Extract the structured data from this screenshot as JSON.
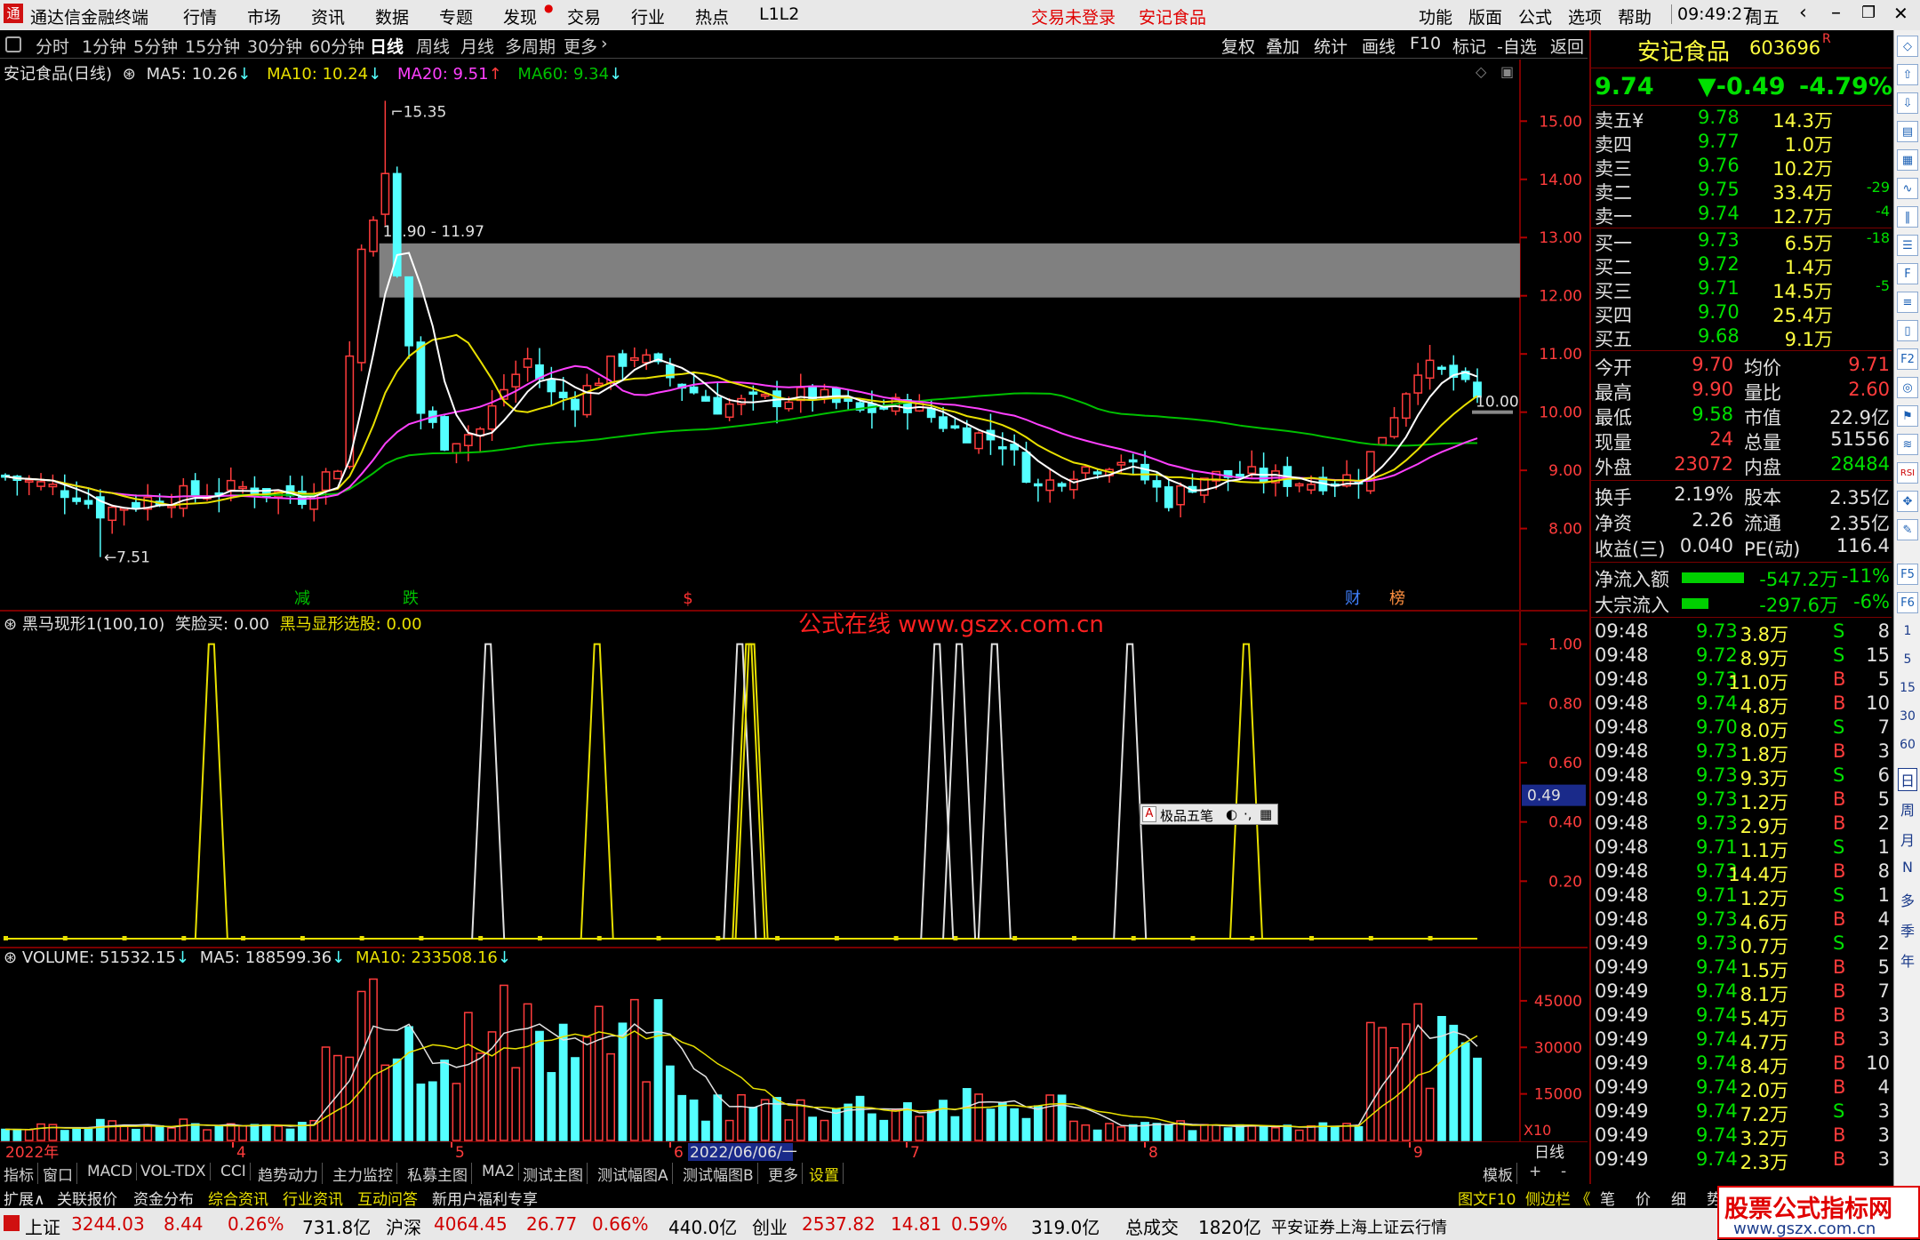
{
  "titlebar": {
    "app_name": "通达信金融终端",
    "menu": [
      "行情",
      "市场",
      "资讯",
      "数据",
      "专题",
      "发现",
      "交易",
      "行业",
      "热点",
      "L1L2"
    ],
    "status_login": "交易未登录",
    "status_stock": "安记食品",
    "right_menu": [
      "功能",
      "版面",
      "公式",
      "选项",
      "帮助"
    ],
    "time": "09:49:27",
    "weekday": "周五"
  },
  "periodbar": {
    "periods": [
      "分时",
      "1分钟",
      "5分钟",
      "15分钟",
      "30分钟",
      "60分钟",
      "日线",
      "周线",
      "月线",
      "多周期",
      "更多"
    ],
    "active": "日线",
    "right_buttons": [
      "复权",
      "叠加",
      "统计",
      "画线",
      "F10",
      "标记",
      "-自选",
      "返回"
    ]
  },
  "main_chart": {
    "legend": {
      "name": "安记食品(日线)",
      "ma5": "MA5: 10.26",
      "ma10": "MA10: 10.24",
      "ma20": "MA20: 9.51",
      "ma60": "MA60: 9.34"
    },
    "high_label": "15.35",
    "low_label": "7.51",
    "box_label": "12.90 - 11.97",
    "last_price_label": "10.00",
    "y_ticks": [
      "15.00",
      "14.00",
      "13.00",
      "12.00",
      "11.00",
      "10.00",
      "9.00",
      "8.00"
    ],
    "markers": [
      {
        "text": "减",
        "color": "#00c000"
      },
      {
        "text": "跌",
        "color": "#00c000"
      },
      {
        "text": "$",
        "color": "#ff3030"
      },
      {
        "text": "财",
        "color": "#4080ff"
      },
      {
        "text": "榜",
        "color": "#ff9040"
      }
    ],
    "colors": {
      "up": "#ff3c3c",
      "down": "#54ffff",
      "ma5": "#ffffff",
      "ma10": "#e8e000",
      "ma20": "#ff40ff",
      "ma60": "#00c000",
      "box": "#808080"
    }
  },
  "indicator": {
    "legend_name": "黑马现形1(100,10)",
    "legend_buy": "笑脸买: 0.00",
    "legend_pick": "黑马显形选股: 0.00",
    "watermark": "公式在线  www.gszx.com.cn",
    "y_ticks": [
      "1.00",
      "0.80",
      "0.60",
      "0.40",
      "0.20"
    ],
    "cursor_value": "0.49",
    "float_toolbar": "极品五笔",
    "yellow_spikes": [
      0.14,
      0.402,
      0.505,
      0.843
    ],
    "white_spikes": [
      0.328,
      0.633,
      0.648,
      0.672,
      0.764
    ],
    "mixed_spikes": [
      0.499
    ]
  },
  "volume": {
    "legend_name": "VOLUME: 51532.15",
    "legend_ma5": "MA5: 188599.36",
    "legend_ma10": "MA10: 233508.16",
    "y_ticks": [
      "45000",
      "30000",
      "15000"
    ],
    "unit": "X10",
    "period_label": "日线"
  },
  "date_axis": {
    "year": "2022年",
    "months": [
      "4",
      "5",
      "6",
      "7",
      "8",
      "9"
    ],
    "cursor_date": "2022/06/06/一"
  },
  "quote": {
    "name": "安记食品",
    "code": "603696",
    "r_mark": "R",
    "price": "9.74",
    "change": "▼-0.49",
    "change_pct": "-4.79%",
    "asks": [
      {
        "label": "卖五",
        "mark": "¥",
        "price": "9.78",
        "vol": "14.3万",
        "diff": ""
      },
      {
        "label": "卖四",
        "mark": "",
        "price": "9.77",
        "vol": "1.0万",
        "diff": ""
      },
      {
        "label": "卖三",
        "mark": "",
        "price": "9.76",
        "vol": "10.2万",
        "diff": ""
      },
      {
        "label": "卖二",
        "mark": "",
        "price": "9.75",
        "vol": "33.4万",
        "diff": "-29"
      },
      {
        "label": "卖一",
        "mark": "",
        "price": "9.74",
        "vol": "12.7万",
        "diff": "-4"
      }
    ],
    "bids": [
      {
        "label": "买一",
        "price": "9.73",
        "vol": "6.5万",
        "diff": "-18"
      },
      {
        "label": "买二",
        "price": "9.72",
        "vol": "1.4万",
        "diff": ""
      },
      {
        "label": "买三",
        "price": "9.71",
        "vol": "14.5万",
        "diff": "-5"
      },
      {
        "label": "买四",
        "price": "9.70",
        "vol": "25.4万",
        "diff": ""
      },
      {
        "label": "买五",
        "price": "9.68",
        "vol": "9.1万",
        "diff": ""
      }
    ],
    "stats": [
      {
        "l1": "今开",
        "v1": "9.70",
        "l2": "均价",
        "v2": "9.71",
        "c1": "#ff3c3c",
        "c2": "#ff3c3c"
      },
      {
        "l1": "最高",
        "v1": "9.90",
        "l2": "量比",
        "v2": "2.60",
        "c1": "#ff3c3c",
        "c2": "#ff3c3c"
      },
      {
        "l1": "最低",
        "v1": "9.58",
        "l2": "市值",
        "v2": "22.9亿",
        "c1": "#00e000",
        "c2": "#e0e0e0"
      },
      {
        "l1": "现量",
        "v1": "24",
        "l2": "总量",
        "v2": "51556",
        "c1": "#ff3c3c",
        "c2": "#e0e0e0"
      },
      {
        "l1": "外盘",
        "v1": "23072",
        "l2": "内盘",
        "v2": "28484",
        "c1": "#ff3c3c",
        "c2": "#00e000"
      }
    ],
    "stats2": [
      {
        "l1": "换手",
        "v1": "2.19%",
        "l2": "股本",
        "v2": "2.35亿"
      },
      {
        "l1": "净资",
        "v1": "2.26",
        "l2": "流通",
        "v2": "2.35亿"
      },
      {
        "l1": "收益(三)",
        "v1": "0.040",
        "l2": "PE(动)",
        "v2": "116.4"
      }
    ],
    "flows": [
      {
        "label": "净流入额",
        "value": "-547.2万",
        "pct": "-11%",
        "bar": 0.7
      },
      {
        "label": "大宗流入",
        "value": "-297.6万",
        "pct": "-6%",
        "bar": 0.3
      }
    ],
    "ticks": [
      {
        "t": "09:48",
        "p": "9.73",
        "v": "3.8万",
        "s": "S",
        "n": "8"
      },
      {
        "t": "09:48",
        "p": "9.72",
        "v": "8.9万",
        "s": "S",
        "n": "15"
      },
      {
        "t": "09:48",
        "p": "9.73",
        "v": "11.0万",
        "s": "B",
        "n": "5"
      },
      {
        "t": "09:48",
        "p": "9.74",
        "v": "4.8万",
        "s": "B",
        "n": "10"
      },
      {
        "t": "09:48",
        "p": "9.70",
        "v": "8.0万",
        "s": "S",
        "n": "7"
      },
      {
        "t": "09:48",
        "p": "9.73",
        "v": "1.8万",
        "s": "B",
        "n": "3"
      },
      {
        "t": "09:48",
        "p": "9.73",
        "v": "9.3万",
        "s": "S",
        "n": "6"
      },
      {
        "t": "09:48",
        "p": "9.73",
        "v": "1.2万",
        "s": "B",
        "n": "5"
      },
      {
        "t": "09:48",
        "p": "9.73",
        "v": "2.9万",
        "s": "B",
        "n": "2"
      },
      {
        "t": "09:48",
        "p": "9.71",
        "v": "1.1万",
        "s": "S",
        "n": "1"
      },
      {
        "t": "09:48",
        "p": "9.73",
        "v": "14.4万",
        "s": "B",
        "n": "8"
      },
      {
        "t": "09:48",
        "p": "9.71",
        "v": "1.2万",
        "s": "S",
        "n": "1"
      },
      {
        "t": "09:48",
        "p": "9.73",
        "v": "4.6万",
        "s": "B",
        "n": "4"
      },
      {
        "t": "09:49",
        "p": "9.73",
        "v": "0.7万",
        "s": "S",
        "n": "2"
      },
      {
        "t": "09:49",
        "p": "9.74",
        "v": "1.5万",
        "s": "B",
        "n": "5"
      },
      {
        "t": "09:49",
        "p": "9.74",
        "v": "8.1万",
        "s": "B",
        "n": "7"
      },
      {
        "t": "09:49",
        "p": "9.74",
        "v": "5.4万",
        "s": "B",
        "n": "3"
      },
      {
        "t": "09:49",
        "p": "9.74",
        "v": "4.7万",
        "s": "B",
        "n": "3"
      },
      {
        "t": "09:49",
        "p": "9.74",
        "v": "8.4万",
        "s": "B",
        "n": "10"
      },
      {
        "t": "09:49",
        "p": "9.74",
        "v": "2.0万",
        "s": "B",
        "n": "4"
      },
      {
        "t": "09:49",
        "p": "9.74",
        "v": "7.2万",
        "s": "S",
        "n": "3"
      },
      {
        "t": "09:49",
        "p": "9.74",
        "v": "3.2万",
        "s": "B",
        "n": "3"
      },
      {
        "t": "09:49",
        "p": "9.74",
        "v": "2.3万",
        "s": "B",
        "n": "3"
      }
    ]
  },
  "tabs1": [
    "指标",
    "窗口",
    "MACD",
    "VOL-TDX",
    "CCI",
    "趋势动力",
    "主力监控",
    "私募主图",
    "MA2",
    "测试主图",
    "测试幅图A",
    "测试幅图B",
    "更多",
    "设置"
  ],
  "tabs1_right": [
    "模板",
    "+",
    "-"
  ],
  "tabs2": [
    "扩展∧",
    "关联报价",
    "资金分布",
    "综合资讯",
    "行业资讯",
    "互动问答",
    "新用户福利专享"
  ],
  "tabs2_right": [
    "图文F10",
    "侧边栏 《",
    "笔",
    "价",
    "细",
    "势"
  ],
  "sidebar_chars": [
    "日",
    "周",
    "月",
    "N",
    "多",
    "季",
    "年"
  ],
  "status": {
    "sh_label": "上证",
    "sh_val": "3244.03",
    "sh_chg": "8.44",
    "sh_pct": "0.26%",
    "sh_amt": "731.8亿",
    "sz_label": "沪深",
    "sz_val": "4064.45",
    "sz_chg": "26.77",
    "sz_pct": "0.66%",
    "sz_amt": "440.0亿",
    "cy_label": "创业",
    "cy_val": "2537.82",
    "cy_chg": "14.81",
    "cy_pct": "0.59%",
    "cy_amt": "319.0亿",
    "total_label": "总成交",
    "total_val": "1820亿",
    "broker": "平安证券上海上证云行情"
  },
  "logo_text": "股票公式指标网",
  "logo_url": "www.gszx.com.cn"
}
